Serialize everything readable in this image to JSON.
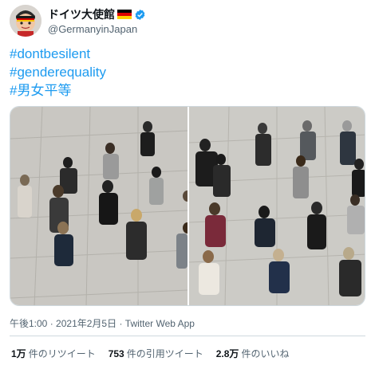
{
  "user": {
    "display_name": "ドイツ大使館",
    "handle": "@GermanyinJapan",
    "verified": true,
    "flag_icon": "germany-flag-icon",
    "avatar_icon": "mascot-avatar-icon"
  },
  "tweet": {
    "hashtags": [
      "#dontbesilent",
      "#genderequality",
      "#男女平等"
    ]
  },
  "media": {
    "images": [
      {
        "name": "group-photo-left"
      },
      {
        "name": "group-photo-right"
      }
    ]
  },
  "meta": {
    "time": "午後1:00",
    "separator": "·",
    "date": "2021年2月5日",
    "source": "Twitter Web App"
  },
  "stats": {
    "retweets": {
      "count": "1万",
      "label": "件のリツイート"
    },
    "quotes": {
      "count": "753",
      "label": "件の引用ツイート"
    },
    "likes": {
      "count": "2.8万",
      "label": "件のいいね"
    }
  },
  "colors": {
    "hashtag": "#1d9bf0",
    "muted": "#536471",
    "verified": "#1d9bf0"
  }
}
